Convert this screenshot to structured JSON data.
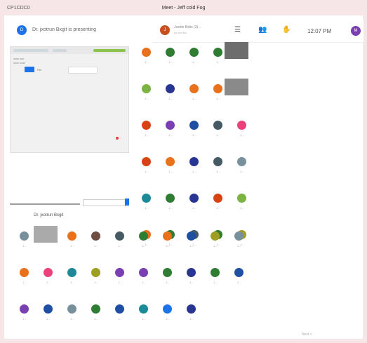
{
  "window": {
    "left_title": "CP1CDC0",
    "center_title": "Meet - Jeff cold Fog"
  },
  "presenting": {
    "text": "Dr. jxotrun Bxgit is presenting"
  },
  "call": {
    "caller_name": "Jxsrtin Bxtis (3)...",
    "caller_sub": "xx xxx xxx",
    "time": "12:07 PM"
  },
  "icons": [
    "list-icon",
    "people-icon",
    "hand-icon"
  ],
  "shared_screen": {
    "tab1": "xxxx xxx",
    "tab2": "xxxx xxxx",
    "file_label": "File",
    "search_placeholder": "xxxx"
  },
  "people_label": "Dr. jxotrun Bxgit",
  "tile_label": "J...",
  "footer": {
    "text": "Next >"
  },
  "colors": {
    "orange": "#e8711a",
    "green": "#2e7d32",
    "lime": "#7cb342",
    "olive": "#9e9d24",
    "blue": "#1e4fa3",
    "navy": "#283593",
    "purple": "#7b3fb4",
    "teal": "#1a8a96",
    "red": "#d84315",
    "pink": "#ec407a",
    "gray": "#78909c",
    "darkgray": "#455a64",
    "lblue": "#1a73e8",
    "brown": "#6d4c41"
  }
}
